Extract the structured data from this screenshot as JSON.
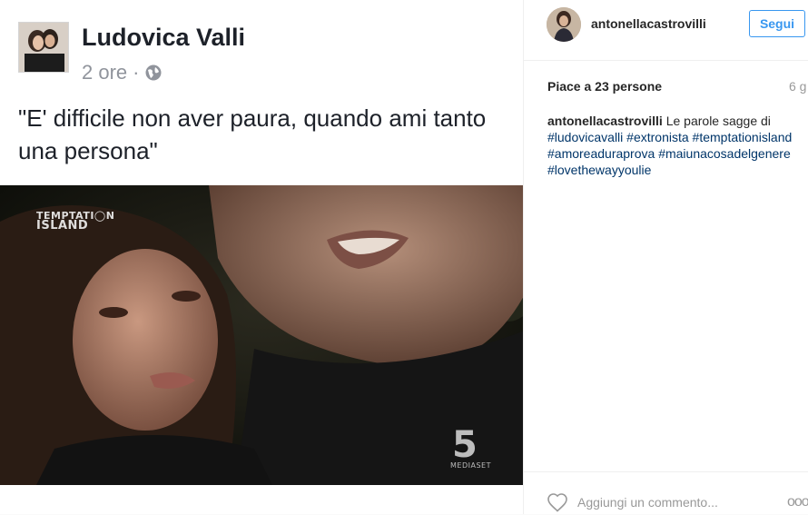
{
  "media": {
    "fb_name": "Ludovica Valli",
    "fb_time": "2 ore",
    "fb_separator": "·",
    "fb_quote": "\"E' difficile non aver paura, quando ami tanto una persona\"",
    "tv_logo_line1": "TEMPTATI◯N",
    "tv_logo_line2": "ISLAND",
    "channel_logo": "5",
    "channel_sub": "MEDIASET"
  },
  "sidebar": {
    "username": "antonellacastrovilli",
    "follow_label": "Segui",
    "likes": "Piace a 23 persone",
    "timestamp": "6 g",
    "caption": {
      "user": "antonellacastrovilli",
      "text": "Le parole sagge di",
      "hashtags": [
        "#ludovicavalli",
        "#extronista",
        "#temptationisland",
        "#amoreaduraprova",
        "#maiunacosadelgenere",
        "#lovethewayyoulie"
      ]
    },
    "comment_placeholder": "Aggiungi un commento...",
    "more_label": "ooo"
  },
  "colors": {
    "accent": "#3897f0",
    "hashtag": "#003569",
    "muted": "#999999"
  }
}
